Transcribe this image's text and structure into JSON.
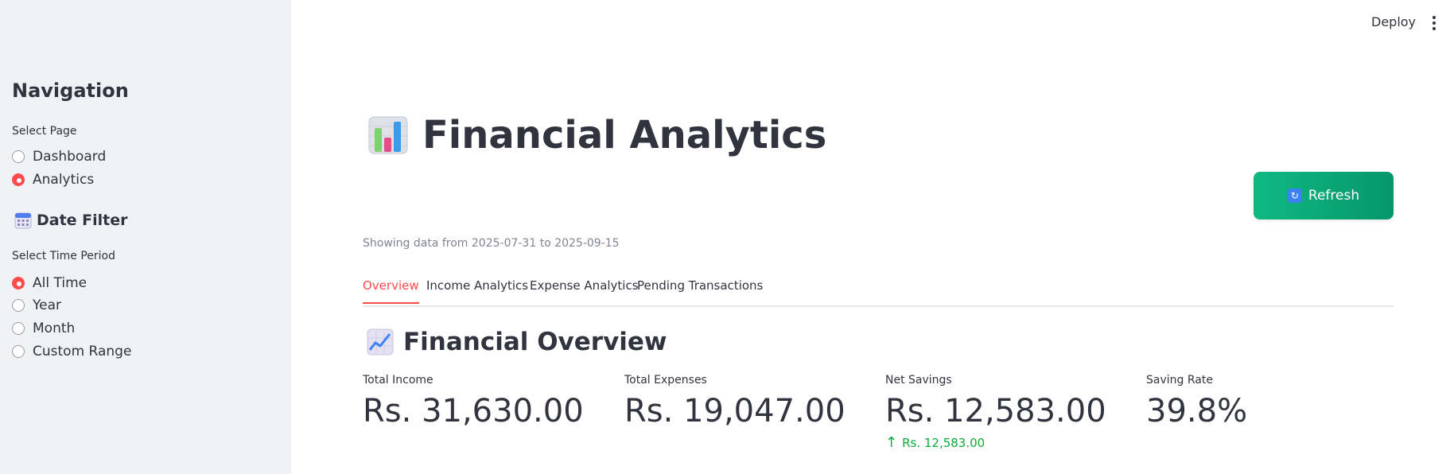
{
  "header": {
    "deploy_label": "Deploy",
    "menu_icon": "kebab-menu-icon"
  },
  "sidebar": {
    "title": "Navigation",
    "page_select": {
      "label": "Select Page",
      "options": [
        {
          "label": "Dashboard",
          "checked": false
        },
        {
          "label": "Analytics",
          "checked": true
        }
      ]
    },
    "date_filter": {
      "icon": "calendar-icon",
      "title": "Date Filter",
      "label": "Select Time Period",
      "options": [
        {
          "label": "All Time",
          "checked": true
        },
        {
          "label": "Year",
          "checked": false
        },
        {
          "label": "Month",
          "checked": false
        },
        {
          "label": "Custom Range",
          "checked": false
        }
      ]
    }
  },
  "main": {
    "title_icon": "bar-chart-icon",
    "title": "Financial Analytics",
    "refresh_icon": "refresh-icon",
    "refresh_label": "Refresh",
    "caption": "Showing data from 2025-07-31 to 2025-09-15",
    "tabs": [
      {
        "label": "Overview",
        "active": true
      },
      {
        "label": "Income Analytics",
        "active": false
      },
      {
        "label": "Expense Analytics",
        "active": false
      },
      {
        "label": "Pending Transactions",
        "active": false
      }
    ],
    "section_icon": "trend-chart-icon",
    "section_title": "Financial Overview",
    "metrics": [
      {
        "label": "Total Income",
        "value": "Rs. 31,630.00"
      },
      {
        "label": "Total Expenses",
        "value": "Rs. 19,047.00"
      },
      {
        "label": "Net Savings",
        "value": "Rs. 12,583.00",
        "delta": "Rs. 12,583.00",
        "delta_icon": "arrow-up-icon"
      },
      {
        "label": "Saving Rate",
        "value": "39.8%"
      }
    ],
    "colors": {
      "accent": "#ff4b4b",
      "refresh_button": "#10b981",
      "delta_positive": "#09ab3b",
      "sidebar_bg": "#f0f2f6"
    }
  }
}
